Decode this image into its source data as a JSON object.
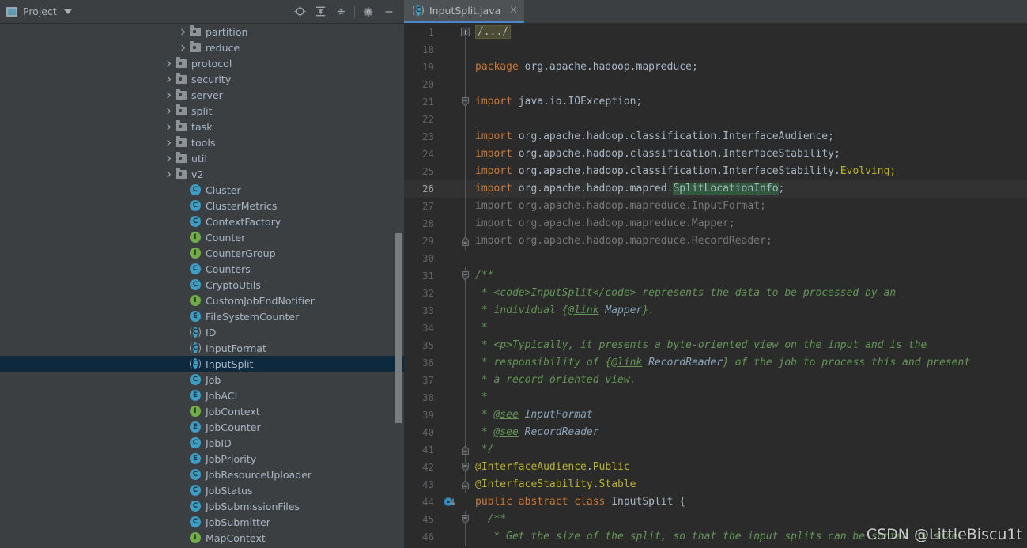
{
  "sidebar": {
    "title": "Project",
    "title_icon": "project-window-icon",
    "dropdown_icon": "chevron-down-icon",
    "toolbar": [
      {
        "name": "locate-icon",
        "label": "Select Opened File"
      },
      {
        "name": "expand-all-icon",
        "label": "Expand All"
      },
      {
        "name": "collapse-all-icon",
        "label": "Collapse All"
      },
      {
        "name": "gear-icon",
        "label": "Settings"
      },
      {
        "name": "minimize-icon",
        "label": "Hide"
      }
    ],
    "tree": [
      {
        "label": "partition",
        "kind": "folder",
        "depth": 2,
        "arrow": "collapsed",
        "selected": false
      },
      {
        "label": "reduce",
        "kind": "folder",
        "depth": 2,
        "arrow": "collapsed",
        "selected": false
      },
      {
        "label": "protocol",
        "kind": "folder",
        "depth": 1,
        "arrow": "collapsed",
        "selected": false
      },
      {
        "label": "security",
        "kind": "folder",
        "depth": 1,
        "arrow": "collapsed",
        "selected": false
      },
      {
        "label": "server",
        "kind": "folder",
        "depth": 1,
        "arrow": "collapsed",
        "selected": false
      },
      {
        "label": "split",
        "kind": "folder",
        "depth": 1,
        "arrow": "collapsed",
        "selected": false
      },
      {
        "label": "task",
        "kind": "folder",
        "depth": 1,
        "arrow": "collapsed",
        "selected": false
      },
      {
        "label": "tools",
        "kind": "folder",
        "depth": 1,
        "arrow": "collapsed",
        "selected": false
      },
      {
        "label": "util",
        "kind": "folder",
        "depth": 1,
        "arrow": "collapsed",
        "selected": false
      },
      {
        "label": "v2",
        "kind": "folder",
        "depth": 1,
        "arrow": "collapsed",
        "selected": false
      },
      {
        "label": "Cluster",
        "kind": "class",
        "depth": 2,
        "arrow": "none",
        "selected": false
      },
      {
        "label": "ClusterMetrics",
        "kind": "class",
        "depth": 2,
        "arrow": "none",
        "selected": false
      },
      {
        "label": "ContextFactory",
        "kind": "class",
        "depth": 2,
        "arrow": "none",
        "selected": false
      },
      {
        "label": "Counter",
        "kind": "interface",
        "depth": 2,
        "arrow": "none",
        "selected": false
      },
      {
        "label": "CounterGroup",
        "kind": "interface",
        "depth": 2,
        "arrow": "none",
        "selected": false
      },
      {
        "label": "Counters",
        "kind": "class",
        "depth": 2,
        "arrow": "none",
        "selected": false
      },
      {
        "label": "CryptoUtils",
        "kind": "class",
        "depth": 2,
        "arrow": "none",
        "selected": false
      },
      {
        "label": "CustomJobEndNotifier",
        "kind": "interface",
        "depth": 2,
        "arrow": "none",
        "selected": false
      },
      {
        "label": "FileSystemCounter",
        "kind": "enum",
        "depth": 2,
        "arrow": "none",
        "selected": false
      },
      {
        "label": "ID",
        "kind": "abstract",
        "depth": 2,
        "arrow": "none",
        "selected": false
      },
      {
        "label": "InputFormat",
        "kind": "abstract",
        "depth": 2,
        "arrow": "none",
        "selected": false
      },
      {
        "label": "InputSplit",
        "kind": "abstract",
        "depth": 2,
        "arrow": "none",
        "selected": true
      },
      {
        "label": "Job",
        "kind": "class",
        "depth": 2,
        "arrow": "none",
        "selected": false
      },
      {
        "label": "JobACL",
        "kind": "enum",
        "depth": 2,
        "arrow": "none",
        "selected": false
      },
      {
        "label": "JobContext",
        "kind": "interface",
        "depth": 2,
        "arrow": "none",
        "selected": false
      },
      {
        "label": "JobCounter",
        "kind": "enum",
        "depth": 2,
        "arrow": "none",
        "selected": false
      },
      {
        "label": "JobID",
        "kind": "class",
        "depth": 2,
        "arrow": "none",
        "selected": false
      },
      {
        "label": "JobPriority",
        "kind": "enum",
        "depth": 2,
        "arrow": "none",
        "selected": false
      },
      {
        "label": "JobResourceUploader",
        "kind": "class",
        "depth": 2,
        "arrow": "none",
        "selected": false
      },
      {
        "label": "JobStatus",
        "kind": "class",
        "depth": 2,
        "arrow": "none",
        "selected": false
      },
      {
        "label": "JobSubmissionFiles",
        "kind": "class",
        "depth": 2,
        "arrow": "none",
        "selected": false
      },
      {
        "label": "JobSubmitter",
        "kind": "class",
        "depth": 2,
        "arrow": "none",
        "selected": false
      },
      {
        "label": "MapContext",
        "kind": "interface",
        "depth": 2,
        "arrow": "none",
        "selected": false
      }
    ]
  },
  "editor": {
    "tab": {
      "label": "InputSplit.java",
      "icon": "abstract-class-icon",
      "close_icon": "close-icon",
      "active": true
    },
    "lines": [
      {
        "num": "1",
        "fold": "plus-box",
        "current": false,
        "tokens": [
          {
            "t": "/.../",
            "c": "folded"
          }
        ]
      },
      {
        "num": "18",
        "fold": "line",
        "current": false,
        "tokens": []
      },
      {
        "num": "19",
        "fold": "line",
        "current": false,
        "tokens": [
          {
            "t": "package ",
            "c": "kw"
          },
          {
            "t": "org.apache.hadoop.mapreduce;",
            "c": "idn"
          }
        ]
      },
      {
        "num": "20",
        "fold": "line",
        "current": false,
        "tokens": []
      },
      {
        "num": "21",
        "fold": "collapse-start",
        "current": false,
        "tokens": [
          {
            "t": "import ",
            "c": "kw"
          },
          {
            "t": "java.io.IOException;",
            "c": "idn"
          }
        ]
      },
      {
        "num": "22",
        "fold": "line",
        "current": false,
        "tokens": []
      },
      {
        "num": "23",
        "fold": "line",
        "current": false,
        "tokens": [
          {
            "t": "import ",
            "c": "kw"
          },
          {
            "t": "org.apache.hadoop.classification.InterfaceAudience;",
            "c": "idn"
          }
        ]
      },
      {
        "num": "24",
        "fold": "line",
        "current": false,
        "tokens": [
          {
            "t": "import ",
            "c": "kw"
          },
          {
            "t": "org.apache.hadoop.classification.InterfaceStability;",
            "c": "idn"
          }
        ]
      },
      {
        "num": "25",
        "fold": "line",
        "current": false,
        "tokens": [
          {
            "t": "import ",
            "c": "kw"
          },
          {
            "t": "org.apache.hadoop.classification.InterfaceStability.",
            "c": "idn"
          },
          {
            "t": "Evolving;",
            "c": "anno"
          }
        ]
      },
      {
        "num": "26",
        "fold": "line",
        "current": true,
        "tokens": [
          {
            "t": "import ",
            "c": "kw"
          },
          {
            "t": "org.apache.hadoop.mapred.",
            "c": "idn"
          },
          {
            "t": "SplitLocationInfo",
            "c": "idn srch"
          },
          {
            "t": ";",
            "c": "idn"
          }
        ]
      },
      {
        "num": "27",
        "fold": "line",
        "current": false,
        "tokens": [
          {
            "t": "import org.apache.hadoop.mapreduce.InputFormat;",
            "c": "dim"
          }
        ]
      },
      {
        "num": "28",
        "fold": "line",
        "current": false,
        "tokens": [
          {
            "t": "import org.apache.hadoop.mapreduce.Mapper;",
            "c": "dim"
          }
        ]
      },
      {
        "num": "29",
        "fold": "collapse-end",
        "current": false,
        "tokens": [
          {
            "t": "import org.apache.hadoop.mapreduce.RecordReader;",
            "c": "dim"
          }
        ]
      },
      {
        "num": "30",
        "fold": "none",
        "current": false,
        "tokens": []
      },
      {
        "num": "31",
        "fold": "collapse-start",
        "current": false,
        "tokens": [
          {
            "t": "/**",
            "c": "cmt"
          }
        ]
      },
      {
        "num": "32",
        "fold": "line",
        "current": false,
        "tokens": [
          {
            "t": " * <code>InputSplit</code> represents the data to be processed by an",
            "c": "cmt"
          }
        ]
      },
      {
        "num": "33",
        "fold": "line",
        "current": false,
        "tokens": [
          {
            "t": " * individual {",
            "c": "cmt"
          },
          {
            "t": "@link",
            "c": "cmt-tag"
          },
          {
            "t": " ",
            "c": "cmt"
          },
          {
            "t": "Mapper",
            "c": "cmt-val"
          },
          {
            "t": "}.",
            "c": "cmt"
          }
        ]
      },
      {
        "num": "34",
        "fold": "line",
        "current": false,
        "tokens": [
          {
            "t": " *",
            "c": "cmt"
          }
        ]
      },
      {
        "num": "35",
        "fold": "line",
        "current": false,
        "tokens": [
          {
            "t": " * <p>Typically, it presents a byte-oriented view on the input and is the",
            "c": "cmt"
          }
        ]
      },
      {
        "num": "36",
        "fold": "line",
        "current": false,
        "tokens": [
          {
            "t": " * responsibility of {",
            "c": "cmt"
          },
          {
            "t": "@link",
            "c": "cmt-tag"
          },
          {
            "t": " ",
            "c": "cmt"
          },
          {
            "t": "RecordReader",
            "c": "cmt-val"
          },
          {
            "t": "} of the job to process this and present",
            "c": "cmt"
          }
        ]
      },
      {
        "num": "37",
        "fold": "line",
        "current": false,
        "tokens": [
          {
            "t": " * a record-oriented view.",
            "c": "cmt"
          }
        ]
      },
      {
        "num": "38",
        "fold": "line",
        "current": false,
        "tokens": [
          {
            "t": " *",
            "c": "cmt"
          }
        ]
      },
      {
        "num": "39",
        "fold": "line",
        "current": false,
        "tokens": [
          {
            "t": " * ",
            "c": "cmt"
          },
          {
            "t": "@see",
            "c": "cmt-tag"
          },
          {
            "t": " ",
            "c": "cmt"
          },
          {
            "t": "InputFormat",
            "c": "cmt-val"
          }
        ]
      },
      {
        "num": "40",
        "fold": "line",
        "current": false,
        "tokens": [
          {
            "t": " * ",
            "c": "cmt"
          },
          {
            "t": "@see",
            "c": "cmt-tag"
          },
          {
            "t": " ",
            "c": "cmt"
          },
          {
            "t": "RecordReader",
            "c": "cmt-val"
          }
        ]
      },
      {
        "num": "41",
        "fold": "collapse-end",
        "current": false,
        "tokens": [
          {
            "t": " */",
            "c": "cmt"
          }
        ]
      },
      {
        "num": "42",
        "fold": "collapse-start",
        "current": false,
        "tokens": [
          {
            "t": "@InterfaceAudience",
            "c": "anno"
          },
          {
            "t": ".",
            "c": "idn"
          },
          {
            "t": "Public",
            "c": "anno"
          }
        ]
      },
      {
        "num": "43",
        "fold": "collapse-end",
        "current": false,
        "tokens": [
          {
            "t": "@InterfaceStability",
            "c": "anno"
          },
          {
            "t": ".",
            "c": "idn"
          },
          {
            "t": "Stable",
            "c": "anno"
          }
        ]
      },
      {
        "num": "44",
        "fold": "none",
        "marker": "implemented-by-icon",
        "current": false,
        "tokens": [
          {
            "t": "public abstract class ",
            "c": "kw"
          },
          {
            "t": "InputSplit",
            "c": "idn"
          },
          {
            "t": " {",
            "c": "idn"
          }
        ]
      },
      {
        "num": "45",
        "fold": "collapse-start",
        "current": false,
        "tokens": [
          {
            "t": "  /**",
            "c": "cmt"
          }
        ]
      },
      {
        "num": "46",
        "fold": "line",
        "current": false,
        "tokens": [
          {
            "t": "   * Get the size of the split, so that the input splits can be sorted by size.",
            "c": "cmt"
          }
        ]
      }
    ]
  },
  "watermark": {
    "text": "CSDN @LittleBiscu1t"
  },
  "colors": {
    "sidebar_bg": "#3c3f41",
    "editor_bg": "#2b2b2b",
    "selection_bg": "#0d293e",
    "current_line_bg": "#323232",
    "tab_accent": "#4a88c7",
    "keyword": "#cc7832",
    "comment": "#629755",
    "annotation": "#bbb529",
    "identifier": "#a9b7c6",
    "search_highlight": "#32593d",
    "fold_bg": "#4b4a32"
  }
}
